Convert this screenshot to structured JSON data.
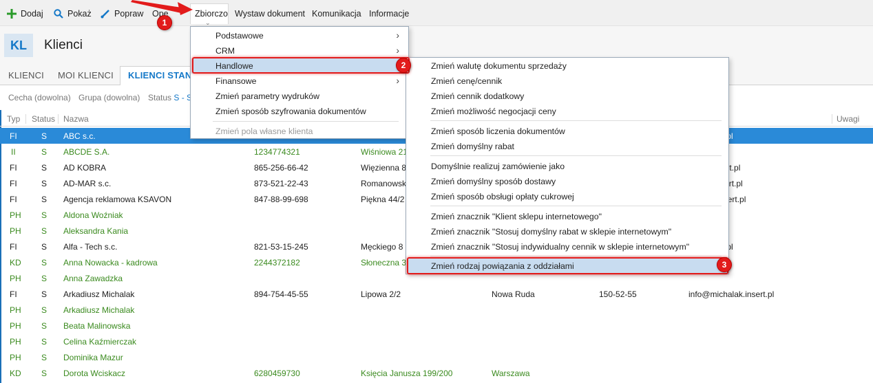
{
  "toolbar": {
    "add": "Dodaj",
    "show": "Pokaż",
    "edit": "Popraw",
    "ops": "Ope",
    "bulk": "Zbiorczo",
    "issue": "Wystaw dokument",
    "comm": "Komunikacja",
    "info": "Informacje"
  },
  "header": {
    "badge": "KL",
    "title": "Klienci"
  },
  "tabs": [
    "KLIENCI",
    "MOI KLIENCI",
    "KLIENCI STAN"
  ],
  "filters": {
    "feature": "Cecha (dowolna)",
    "group": "Grupa (dowolna)",
    "status_label": "Status",
    "status_value": "S - St"
  },
  "columns": {
    "type": "Typ",
    "status": "Status",
    "name": "Nazwa",
    "notes": "Uwagi"
  },
  "rows": [
    {
      "type": "FI",
      "status": "S",
      "name": "ABC s.c.",
      "nip": "",
      "street": "",
      "city": "",
      "zip": "",
      "email": "abc.insert.pl"
    },
    {
      "type": "II",
      "status": "S",
      "name": "ABCDE S.A.",
      "nip": "1234774321",
      "street": "Wiśniowa 21",
      "city": "",
      "zip": "",
      "email": ""
    },
    {
      "type": "FI",
      "status": "S",
      "name": "AD KOBRA",
      "nip": "865-256-66-42",
      "street": "Więzienna 8",
      "city": "",
      "zip": "",
      "email": "kobra.insert.pl"
    },
    {
      "type": "FI",
      "status": "S",
      "name": "AD-MAR s.c.",
      "nip": "873-521-22-43",
      "street": "Romanowsk",
      "city": "",
      "zip": "",
      "email": "admar.insert.pl"
    },
    {
      "type": "FI",
      "status": "S",
      "name": "Agencja reklamowa KSAVON",
      "nip": "847-88-99-698",
      "street": "Piękna 44/2",
      "city": "",
      "zip": "",
      "email": "ksavon.insert.pl"
    },
    {
      "type": "PH",
      "status": "S",
      "name": "Aldona Woźniak",
      "nip": "",
      "street": "",
      "city": "",
      "zip": "",
      "email": ""
    },
    {
      "type": "PH",
      "status": "S",
      "name": "Aleksandra Kania",
      "nip": "",
      "street": "",
      "city": "",
      "zip": "",
      "email": ""
    },
    {
      "type": "FI",
      "status": "S",
      "name": "Alfa - Tech s.c.",
      "nip": "821-53-15-245",
      "street": "Męckiego 8",
      "city": "",
      "zip": "",
      "email": "alfa.insert.pl"
    },
    {
      "type": "KD",
      "status": "S",
      "name": "Anna Nowacka - kadrowa",
      "nip": "2244372182",
      "street": "Słoneczna 3/",
      "city": "",
      "zip": "",
      "email": ""
    },
    {
      "type": "PH",
      "status": "S",
      "name": "Anna Zawadzka",
      "nip": "",
      "street": "",
      "city": "",
      "zip": "",
      "email": ""
    },
    {
      "type": "FI",
      "status": "S",
      "name": "Arkadiusz Michalak",
      "nip": "894-754-45-55",
      "street": "Lipowa  2/2",
      "city": "Nowa Ruda",
      "zip": "150-52-55",
      "email": "info@michalak.insert.pl"
    },
    {
      "type": "PH",
      "status": "S",
      "name": "Arkadiusz Michalak",
      "nip": "",
      "street": "",
      "city": "",
      "zip": "",
      "email": ""
    },
    {
      "type": "PH",
      "status": "S",
      "name": "Beata Malinowska",
      "nip": "",
      "street": "",
      "city": "",
      "zip": "",
      "email": ""
    },
    {
      "type": "PH",
      "status": "S",
      "name": "Celina Kaźmierczak",
      "nip": "",
      "street": "",
      "city": "",
      "zip": "",
      "email": ""
    },
    {
      "type": "PH",
      "status": "S",
      "name": "Dominika Mazur",
      "nip": "",
      "street": "",
      "city": "",
      "zip": "",
      "email": ""
    },
    {
      "type": "KD",
      "status": "S",
      "name": "Dorota Wciskacz",
      "nip": "6280459730",
      "street": "Księcia Janusza 199/200",
      "city": "Warszawa",
      "zip": "",
      "email": ""
    }
  ],
  "menu_bulk": {
    "basic": "Podstawowe",
    "crm": "CRM",
    "trade": "Handlowe",
    "finance": "Finansowe",
    "print_params": "Zmień parametry wydruków",
    "encryption": "Zmień sposób szyfrowania dokumentów",
    "custom_fields": "Zmień pola własne klienta"
  },
  "menu_trade": [
    "Zmień walutę dokumentu sprzedaży",
    "Zmień cenę/cennik",
    "Zmień cennik dodatkowy",
    "Zmień możliwość negocjacji ceny",
    "Zmień sposób liczenia dokumentów",
    "Zmień domyślny rabat",
    "Domyślnie realizuj zamówienie jako",
    "Zmień domyślny sposób dostawy",
    "Zmień sposób obsługi opłaty cukrowej",
    "Zmień znacznik \"Klient sklepu internetowego\"",
    "Zmień znacznik \"Stosuj domyślny rabat w sklepie internetowym\"",
    "Zmień znacznik \"Stosuj indywidualny cennik w sklepie internetowym\"",
    "Zmień rodzaj powiązania z oddziałami"
  ],
  "annotations": {
    "step1": "1",
    "step2": "2",
    "step3": "3"
  },
  "colors": {
    "accent": "#1478c8",
    "selected_row": "#2a8ad8",
    "green_text": "#3a8a1e",
    "annotation": "#e21b1b"
  }
}
